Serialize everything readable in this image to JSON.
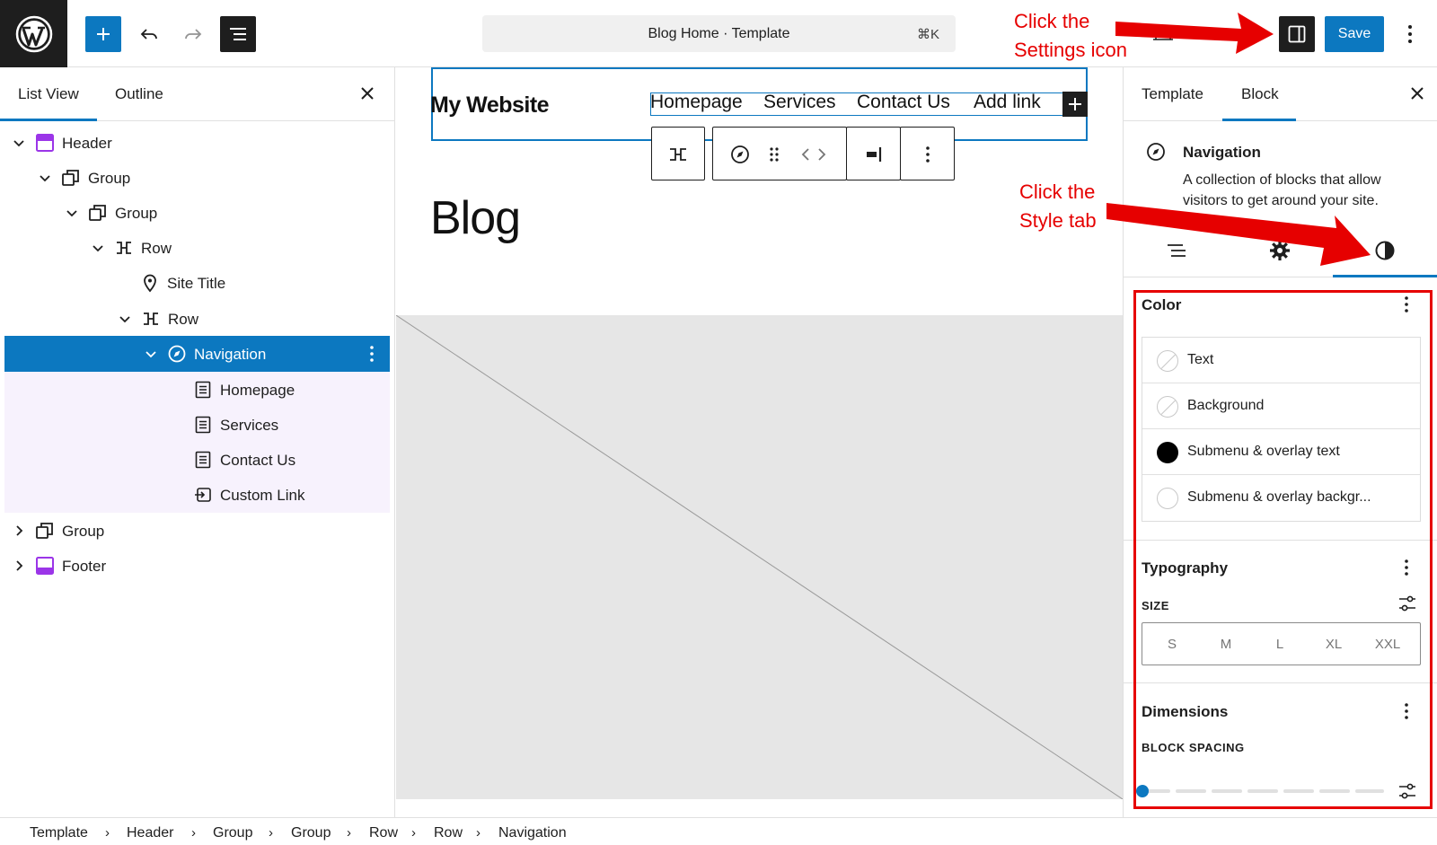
{
  "topbar": {
    "doc_title": "Blog Home · Template",
    "shortcut": "⌘K",
    "save_label": "Save"
  },
  "left_panel": {
    "tabs": [
      "List View",
      "Outline"
    ],
    "tree": [
      {
        "label": "Header",
        "icon": "template-part-icon"
      },
      {
        "label": "Group",
        "icon": "group-icon"
      },
      {
        "label": "Group",
        "icon": "group-icon"
      },
      {
        "label": "Row",
        "icon": "row-icon"
      },
      {
        "label": "Site Title",
        "icon": "map-marker-icon"
      },
      {
        "label": "Row",
        "icon": "row-icon"
      },
      {
        "label": "Navigation",
        "icon": "navigation-compass-icon"
      },
      {
        "label": "Homepage",
        "icon": "page-icon"
      },
      {
        "label": "Services",
        "icon": "page-icon"
      },
      {
        "label": "Contact Us",
        "icon": "page-icon"
      },
      {
        "label": "Custom Link",
        "icon": "custom-link-icon"
      },
      {
        "label": "Group",
        "icon": "group-icon"
      },
      {
        "label": "Footer",
        "icon": "template-part-icon"
      }
    ]
  },
  "canvas": {
    "site_title": "My Website",
    "nav_links": [
      "Homepage",
      "Services",
      "Contact Us",
      "Add link"
    ],
    "heading": "Blog"
  },
  "right_panel": {
    "tabs": [
      "Template",
      "Block"
    ],
    "block_title": "Navigation",
    "block_description": "A collection of blocks that allow visitors to get around your site.",
    "color": {
      "heading": "Color",
      "items": [
        {
          "label": "Text",
          "swatch": "none"
        },
        {
          "label": "Background",
          "swatch": "none"
        },
        {
          "label": "Submenu & overlay text",
          "swatch": "#000000"
        },
        {
          "label": "Submenu & overlay backgr...",
          "swatch": "#ffffff"
        }
      ]
    },
    "typography": {
      "heading": "Typography",
      "size_label": "SIZE",
      "sizes": [
        "S",
        "M",
        "L",
        "XL",
        "XXL"
      ]
    },
    "dimensions": {
      "heading": "Dimensions",
      "spacing_label": "BLOCK SPACING",
      "spacing_value": 0
    }
  },
  "breadcrumbs": [
    "Template",
    "Header",
    "Group",
    "Group",
    "Row",
    "Row",
    "Navigation"
  ],
  "annotations": {
    "settings_line1": "Click the",
    "settings_line2": "Settings icon",
    "style_line1": "Click the",
    "style_line2": "Style tab"
  },
  "colors": {
    "accent": "#0c78c0",
    "annotation": "#e60000",
    "template_part": "#9b35e8"
  }
}
